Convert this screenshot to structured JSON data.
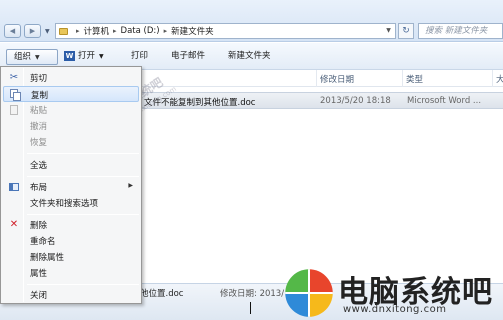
{
  "address_bar": {
    "path": [
      "计算机",
      "Data (D:)",
      "新建文件夹"
    ],
    "search_placeholder": "搜索 新建文件夹"
  },
  "toolbar": {
    "organize": "组织",
    "open": "打开",
    "print": "打印",
    "email": "电子邮件",
    "new_folder": "新建文件夹"
  },
  "columns": {
    "date": "修改日期",
    "type": "类型",
    "size": "大"
  },
  "files": [
    {
      "name": "文件不能复制到其他位置.doc",
      "date": "2013/5/20 18:18",
      "type": "Microsoft Word ..."
    }
  ],
  "context_menu": {
    "items": [
      {
        "label": "剪切",
        "icon": "scissors-icon",
        "disabled": false
      },
      {
        "label": "复制",
        "icon": "copy-icon",
        "disabled": false,
        "highlighted": true
      },
      {
        "label": "粘贴",
        "icon": "paste-icon",
        "disabled": true
      },
      {
        "label": "撤消",
        "disabled": true
      },
      {
        "label": "恢复",
        "disabled": true
      },
      {
        "label": "全选",
        "disabled": false
      },
      {
        "label": "布局",
        "icon": "layout-icon",
        "disabled": false,
        "submenu": true
      },
      {
        "label": "文件夹和搜索选项",
        "disabled": false
      },
      {
        "label": "删除",
        "icon": "delete-icon",
        "disabled": false
      },
      {
        "label": "重命名",
        "disabled": false
      },
      {
        "label": "删除属性",
        "disabled": false
      },
      {
        "label": "属性",
        "disabled": false
      },
      {
        "label": "关闭",
        "disabled": false
      }
    ]
  },
  "details_pane": {
    "file_name_fragment": "他位置.doc",
    "date_fragment": "修改日期: 2013/"
  },
  "watermark": {
    "brand": "电脑系统吧",
    "url": "www.dnxitong.com",
    "small_brand": "电脑系统吧",
    "small_url": "www.dnxitong.com"
  },
  "colors": {
    "highlight": "#d5e6fb",
    "accent": "#2b5ca8",
    "delete_red": "#d0202a"
  }
}
